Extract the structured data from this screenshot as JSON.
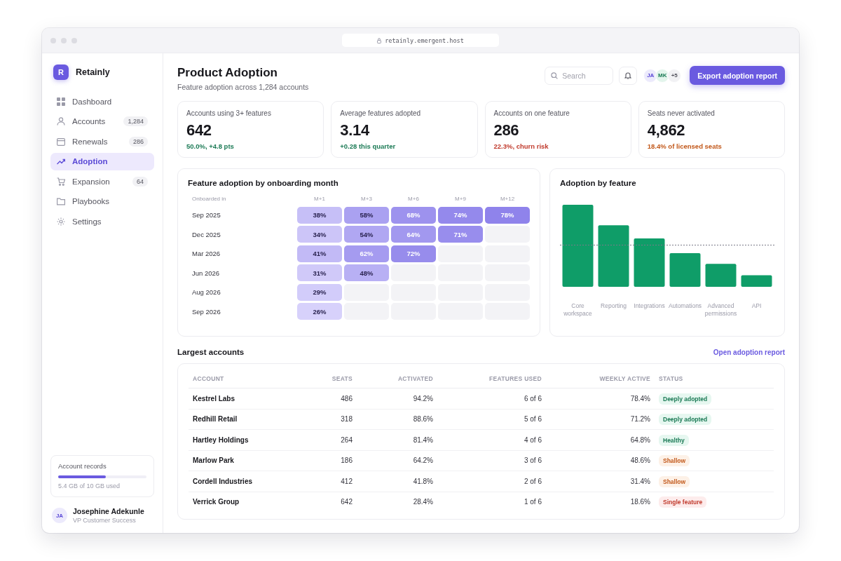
{
  "browser": {
    "url": "retainly.emergent.host"
  },
  "brand": {
    "mark": "R",
    "name": "Retainly"
  },
  "nav": [
    {
      "label": "Dashboard",
      "selected": false
    },
    {
      "label": "Accounts",
      "count": "1,284",
      "selected": false
    },
    {
      "label": "Renewals",
      "count": "286",
      "selected": false
    },
    {
      "label": "Adoption",
      "selected": true
    },
    {
      "label": "Expansion",
      "count": "64",
      "selected": false
    },
    {
      "label": "Playbooks",
      "selected": false
    },
    {
      "label": "Settings",
      "selected": false
    }
  ],
  "storage": {
    "title": "Account records",
    "level": 0.54,
    "caption": "5.4 GB of 10 GB used"
  },
  "user": {
    "initials": "JA",
    "name": "Josephine Adekunle",
    "role": "VP Customer Success"
  },
  "header": {
    "title": "Product Adoption",
    "subtitle": "Feature adoption across 1,284 accounts",
    "search": {
      "placeholder": "Search"
    },
    "avatars": [
      "JA",
      "MK",
      "+5"
    ],
    "export_button": "Export adoption report"
  },
  "stats": [
    {
      "label": "Accounts using 3+ features",
      "value": "642",
      "delta": "50.0%, +4.8 pts",
      "kind": "positive"
    },
    {
      "label": "Average features adopted",
      "value": "3.14",
      "delta": "+0.28 this quarter",
      "kind": "positive"
    },
    {
      "label": "Accounts on one feature",
      "value": "286",
      "delta": "22.3%, churn risk",
      "kind": "negative"
    },
    {
      "label": "Seats never activated",
      "value": "4,862",
      "delta": "18.4% of licensed seats",
      "kind": "warning"
    }
  ],
  "heatmap": {
    "title": "Feature adoption by onboarding month",
    "row_header": "Onboarded in",
    "columns": [
      "M+1",
      "M+3",
      "M+6",
      "M+9",
      "M+12"
    ],
    "rows": [
      {
        "label": "Sep 2025",
        "cells": [
          "38%",
          "58%",
          "68%",
          "74%",
          "78%"
        ]
      },
      {
        "label": "Dec 2025",
        "cells": [
          "34%",
          "54%",
          "64%",
          "71%"
        ]
      },
      {
        "label": "Mar 2026",
        "cells": [
          "41%",
          "62%",
          "72%"
        ]
      },
      {
        "label": "Jun 2026",
        "cells": [
          "31%",
          "48%"
        ]
      },
      {
        "label": "Aug 2026",
        "cells": [
          "29%"
        ]
      },
      {
        "label": "Sep 2026",
        "cells": [
          "26%"
        ]
      }
    ]
  },
  "feature_chart": {
    "title": "Adoption by feature",
    "categories": [
      "Core workspace",
      "Reporting",
      "Integrations",
      "Automations",
      "Advanced permissions",
      "API"
    ]
  },
  "accounts": {
    "title": "Largest accounts",
    "link": "Open adoption report",
    "columns": [
      "ACCOUNT",
      "SEATS",
      "ACTIVATED",
      "FEATURES USED",
      "WEEKLY ACTIVE",
      "STATUS"
    ],
    "rows": [
      {
        "account": "Kestrel Labs",
        "seats": "486",
        "activated": "94.2%",
        "features": "6 of 6",
        "weekly": "78.4%",
        "status": "Deeply adopted",
        "kind": "good"
      },
      {
        "account": "Redhill Retail",
        "seats": "318",
        "activated": "88.6%",
        "features": "5 of 6",
        "weekly": "71.2%",
        "status": "Deeply adopted",
        "kind": "good"
      },
      {
        "account": "Hartley Holdings",
        "seats": "264",
        "activated": "81.4%",
        "features": "4 of 6",
        "weekly": "64.8%",
        "status": "Healthy",
        "kind": "good"
      },
      {
        "account": "Marlow Park",
        "seats": "186",
        "activated": "64.2%",
        "features": "3 of 6",
        "weekly": "48.6%",
        "status": "Shallow",
        "kind": "warn"
      },
      {
        "account": "Cordell Industries",
        "seats": "412",
        "activated": "41.8%",
        "features": "2 of 6",
        "weekly": "31.4%",
        "status": "Shallow",
        "kind": "warn"
      },
      {
        "account": "Verrick Group",
        "seats": "642",
        "activated": "28.4%",
        "features": "1 of 6",
        "weekly": "18.6%",
        "status": "Single feature",
        "kind": "bad"
      }
    ]
  }
}
